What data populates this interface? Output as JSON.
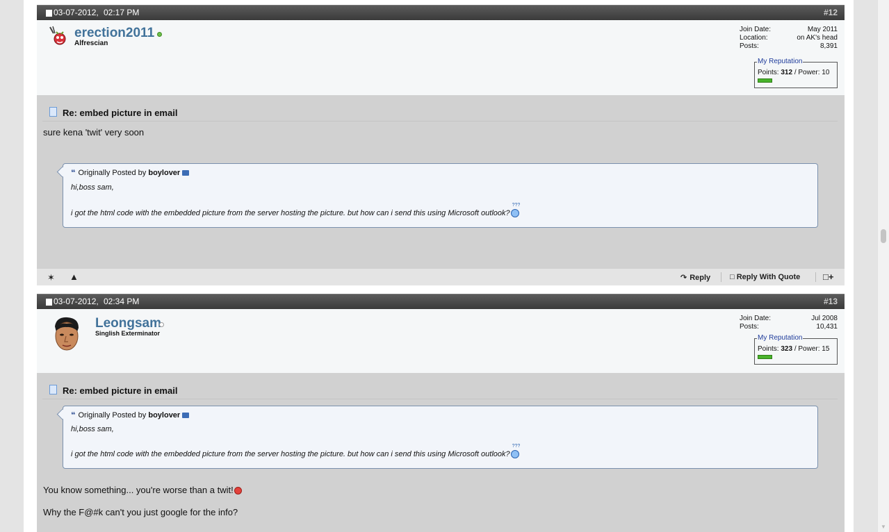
{
  "posts": [
    {
      "date": "03-07-2012,",
      "time": "02:17 PM",
      "number": "#12",
      "username": "erection2011",
      "online": true,
      "user_title": "Alfrescian",
      "stats": [
        {
          "label": "Join Date:",
          "value": "May 2011"
        },
        {
          "label": "Location:",
          "value": "on AK's head"
        },
        {
          "label": "Posts:",
          "value": "8,391"
        }
      ],
      "reputation": {
        "legend": "My Reputation",
        "points_label": "Points:",
        "points": "312",
        "power": "/ Power: 10"
      },
      "title": "Re: embed picture in email",
      "message_before": "sure kena 'twit' very soon",
      "quote": {
        "originally_posted_by": "Originally Posted by",
        "author": "boylover",
        "line1": "hi,boss sam,",
        "line2": "i got the html code with the embedded picture from the server hosting the picture. but how can i send this using Microsoft outlook?",
        "emoticon_text": "???"
      }
    },
    {
      "date": "03-07-2012,",
      "time": "02:34 PM",
      "number": "#13",
      "username": "Leongsam",
      "online": false,
      "user_title": "Singlish Exterminator",
      "stats": [
        {
          "label": "Join Date:",
          "value": "Jul 2008"
        },
        {
          "label": "Posts:",
          "value": "10,431"
        }
      ],
      "reputation": {
        "legend": "My Reputation",
        "points_label": "Points:",
        "points": "323",
        "power": "/ Power: 15"
      },
      "title": "Re: embed picture in email",
      "quote": {
        "originally_posted_by": "Originally Posted by",
        "author": "boylover",
        "line1": "hi,boss sam,",
        "line2": "i got the html code with the embedded picture from the server hosting the picture. but how can i send this using Microsoft outlook?",
        "emoticon_text": "???"
      },
      "message_after_1": "You know something... you're worse than a twit!",
      "message_after_2": "Why the F@#k can't you just google for the info?"
    }
  ],
  "footer": {
    "reply_label": "Reply",
    "reply_with_quote_label": "Reply With Quote"
  },
  "icons": {
    "online": "online-dot-icon",
    "offline": "offline-dot-icon",
    "reply": "reply-arrow-icon",
    "quote": "quote-bubble-icon",
    "multiquote": "multiquote-icon",
    "reputation": "star-icon",
    "report": "warning-icon"
  },
  "colors": {
    "username": "#41729a",
    "header_bar": "#3a3a3a",
    "content_bg": "#d1d1d1",
    "quote_border": "#7a90ad",
    "rep_bar": "#49b32c",
    "online_dot": "#6fbf4a"
  }
}
